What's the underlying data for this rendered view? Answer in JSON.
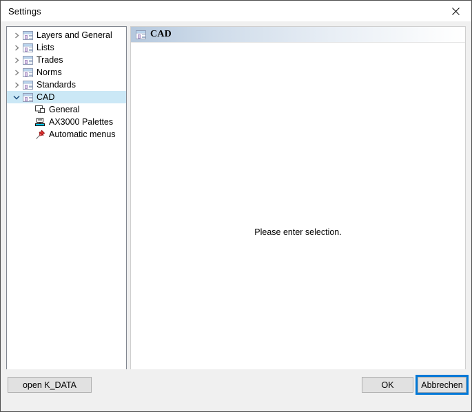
{
  "window": {
    "title": "Settings",
    "close_label": "close-icon"
  },
  "tree": {
    "items": [
      {
        "label": "Layers and General",
        "expander": "chevron-right-icon",
        "icon": "settings-node-icon",
        "level": 0,
        "selected": false
      },
      {
        "label": "Lists",
        "expander": "chevron-right-icon",
        "icon": "settings-node-icon",
        "level": 0,
        "selected": false
      },
      {
        "label": "Trades",
        "expander": "chevron-right-icon",
        "icon": "settings-node-icon",
        "level": 0,
        "selected": false
      },
      {
        "label": "Norms",
        "expander": "chevron-right-icon",
        "icon": "settings-node-icon",
        "level": 0,
        "selected": false
      },
      {
        "label": "Standards",
        "expander": "chevron-right-icon",
        "icon": "settings-node-icon",
        "level": 0,
        "selected": false
      },
      {
        "label": "CAD",
        "expander": "chevron-down-icon",
        "icon": "settings-node-icon",
        "level": 0,
        "selected": true
      },
      {
        "label": "General",
        "expander": "none",
        "icon": "monitor-copy-icon",
        "level": 1,
        "selected": false
      },
      {
        "label": "AX3000 Palettes",
        "expander": "none",
        "icon": "palette-monitor-icon",
        "level": 1,
        "selected": false
      },
      {
        "label": "Automatic menus",
        "expander": "none",
        "icon": "pushpin-icon",
        "level": 1,
        "selected": false
      }
    ]
  },
  "panel": {
    "header_title": "CAD",
    "header_icon": "settings-node-icon",
    "message": "Please enter selection."
  },
  "footer": {
    "open_data_label": "open K_DATA",
    "ok_label": "OK",
    "cancel_label": "Abbrechen"
  },
  "colors": {
    "selection": "#cbe8f6",
    "focus_ring": "#0078d7",
    "button_face": "#e1e1e1",
    "dialog_face": "#f0f0f0",
    "panel_border": "#828790"
  }
}
